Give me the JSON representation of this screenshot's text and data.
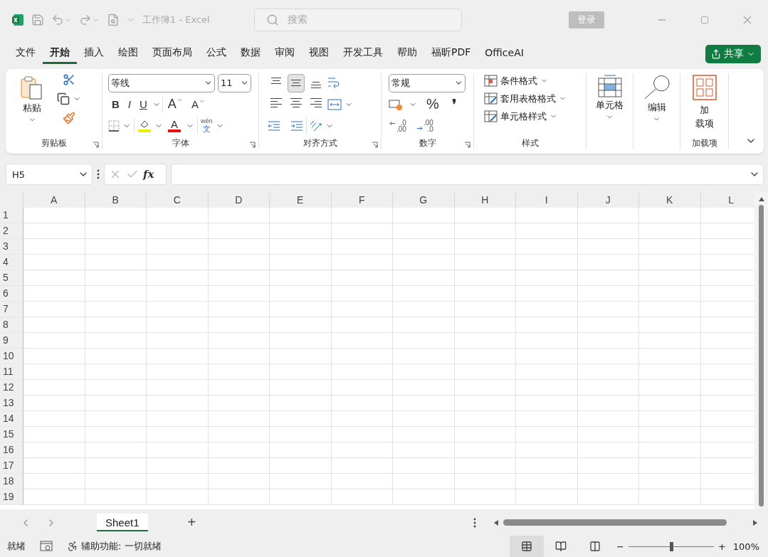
{
  "title_bar": {
    "title": "工作簿1  -  Excel",
    "search": {
      "placeholder": "搜索"
    },
    "login": "登录"
  },
  "tabs": [
    {
      "label": "文件",
      "selected": false
    },
    {
      "label": "开始",
      "selected": true
    },
    {
      "label": "插入",
      "selected": false
    },
    {
      "label": "绘图",
      "selected": false
    },
    {
      "label": "页面布局",
      "selected": false
    },
    {
      "label": "公式",
      "selected": false
    },
    {
      "label": "数据",
      "selected": false
    },
    {
      "label": "审阅",
      "selected": false
    },
    {
      "label": "视图",
      "selected": false
    },
    {
      "label": "开发工具",
      "selected": false
    },
    {
      "label": "帮助",
      "selected": false
    },
    {
      "label": "福昕PDF",
      "selected": false
    },
    {
      "label": "OfficeAI",
      "selected": false
    }
  ],
  "share": "共享",
  "ribbon": {
    "clipboard": {
      "paste": "粘贴",
      "label": "剪贴板"
    },
    "font": {
      "font_name": "等线",
      "font_size": "11",
      "bold": "B",
      "italic": "I",
      "underline": "U",
      "grow": "A",
      "shrink": "A",
      "font_color_letter": "A",
      "phonetic_top": "wén",
      "phonetic_bottom": "文",
      "label": "字体"
    },
    "alignment": {
      "vertical": [
        {
          "kind": "top",
          "selected": false
        },
        {
          "kind": "middle",
          "selected": true
        },
        {
          "kind": "bottom",
          "selected": false
        }
      ],
      "label": "对齐方式"
    },
    "number": {
      "format": "常规",
      "percent": "%",
      "comma": "❜",
      "decimals": [
        {
          "kind": "increase",
          "top": ".0",
          "bottom": ".00"
        },
        {
          "kind": "decrease",
          "top": ".00",
          "bottom": ".0"
        }
      ],
      "label": "数字"
    },
    "styles": {
      "buttons": [
        "条件格式",
        "套用表格格式",
        "单元格样式"
      ],
      "label": "样式"
    },
    "cells": {
      "label": "单元格"
    },
    "editing": {
      "label": "编辑"
    },
    "addins": {
      "button_lines": [
        "加",
        "载项"
      ],
      "label": "加载项"
    }
  },
  "formula_bar": {
    "name_box": "H5",
    "fx": "fx"
  },
  "grid": {
    "columns": [
      "A",
      "B",
      "C",
      "D",
      "E",
      "F",
      "G",
      "H",
      "I",
      "J",
      "K",
      "L"
    ],
    "rows": [
      "1",
      "2",
      "3",
      "4",
      "5",
      "6",
      "7",
      "8",
      "9",
      "10",
      "11",
      "12",
      "13",
      "14",
      "15",
      "16",
      "17",
      "18",
      "19"
    ]
  },
  "sheets": [
    {
      "label": "Sheet1",
      "selected": true
    }
  ],
  "add_sheet": "+",
  "status_bar": {
    "ready": "就绪",
    "accessibility": "辅助功能: 一切就绪",
    "views": [
      {
        "kind": "normal",
        "selected": true
      },
      {
        "kind": "page_layout",
        "selected": false
      },
      {
        "kind": "page_break",
        "selected": false
      }
    ],
    "zoom_out": "−",
    "zoom_in": "+",
    "zoom": {
      "level": 0.5
    },
    "zoom_text": "100%"
  }
}
